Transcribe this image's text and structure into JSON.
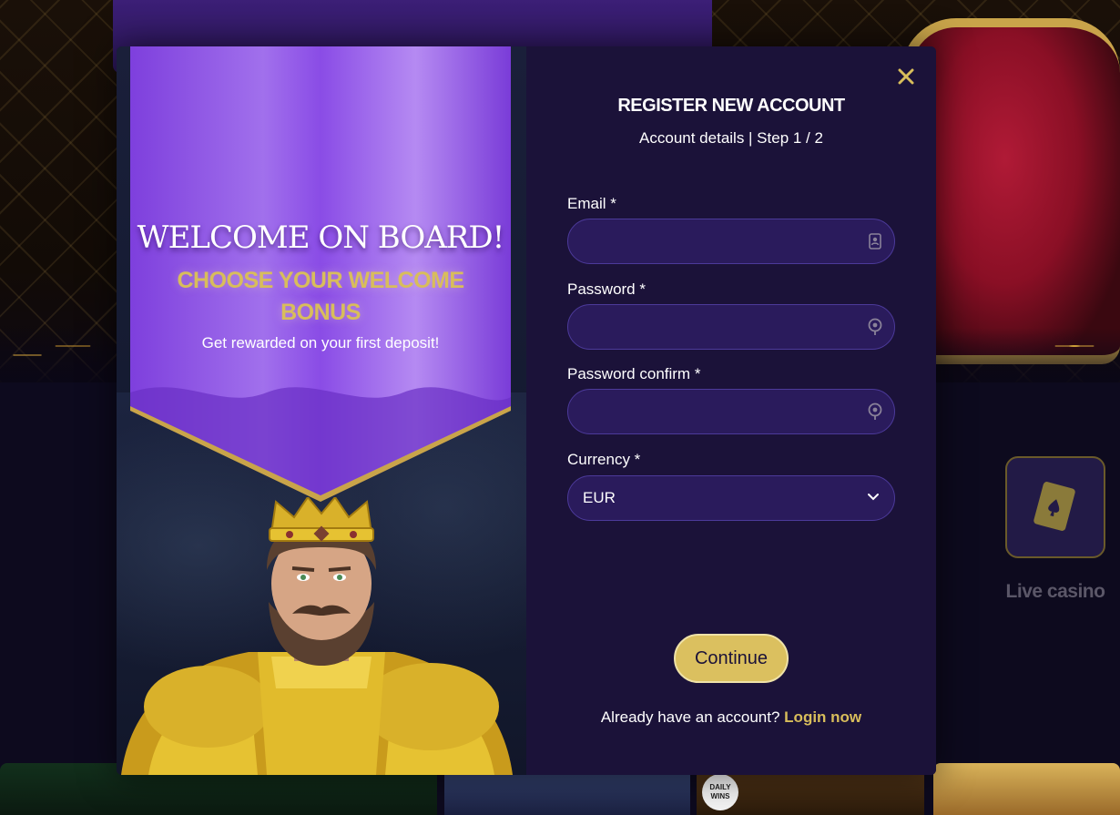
{
  "background": {
    "live_casino_label": "Live casino",
    "live_casino_icon": "playing-card-icon",
    "thumb_daily_wins": "DAILY WINS"
  },
  "promo": {
    "welcome_title": "WELCOME ON BOARD!",
    "choose_bonus": "CHOOSE YOUR WELCOME BONUS",
    "subtitle": "Get rewarded on your first deposit!"
  },
  "form": {
    "title": "REGISTER NEW ACCOUNT",
    "step": "Account details | Step 1 / 2",
    "email_label": "Email *",
    "email_value": "",
    "password_label": "Password *",
    "password_value": "",
    "password_confirm_label": "Password confirm *",
    "password_confirm_value": "",
    "currency_label": "Currency *",
    "currency_value": "EUR",
    "continue_label": "Continue",
    "login_prompt": "Already have an account?",
    "login_link": "Login now"
  },
  "colors": {
    "accent_gold": "#d8bd5b",
    "modal_bg": "#1b1239",
    "input_bg": "#2a1b5c",
    "banner_purple": "#8b4be8"
  }
}
